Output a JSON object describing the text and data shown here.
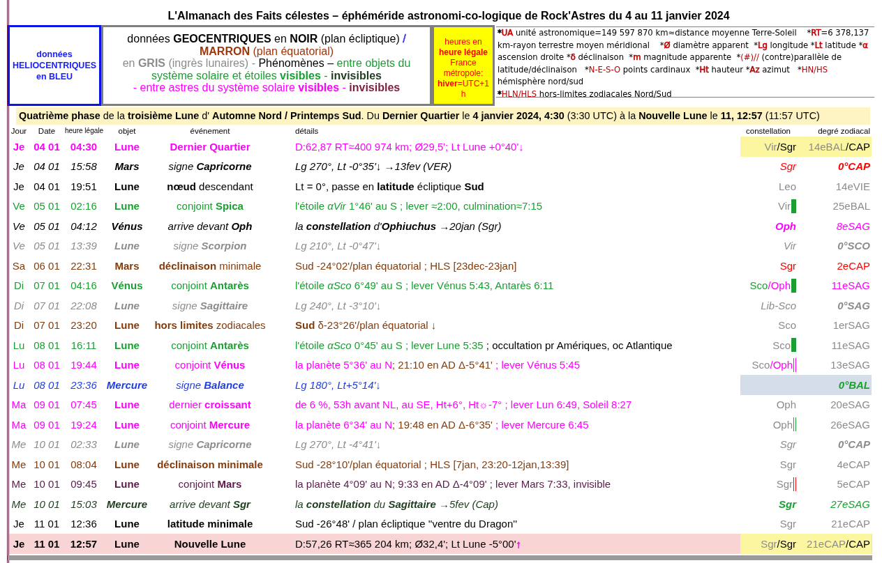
{
  "title": "L'Almanach des Faits célestes – éphéméride astronomi-co-logique de Rock'Astres du 4 au 11 janvier 2024",
  "legend": {
    "heliocentric": "données HELIOCENTRIQUES en BLEU",
    "geocentric": [
      [
        {
          "text": "données **GEOCENTRIQUES** en **NOIR** (plan écliptique)  ",
          "color": "#000000"
        },
        {
          "text": "/",
          "color": "#3030ff"
        }
      ],
      [
        {
          "text": "**MARRON** (plan équatorial)",
          "color": "#a0360c"
        }
      ],
      [
        {
          "text": "en **GRIS** (ingrès lunaires)  -  ",
          "color": "#8c8c8c"
        },
        {
          "text": "Phénomènes – ",
          "color": "#000000"
        },
        {
          "text": "entre objets du",
          "color": "#1aa032"
        }
      ],
      [
        {
          "text": "système solaire et étoiles **visibles** - ",
          "color": "#1aa032"
        },
        {
          "text": "**invisibles**",
          "color": "#1e3d1e"
        }
      ],
      [
        {
          "text": "- entre astres du système solaire **visibles** - ",
          "color": "#ff00ff"
        },
        {
          "text": "**invisibles**",
          "color": "#7a1f3d"
        }
      ]
    ],
    "time": [
      [
        {
          "text": "heures en",
          "color": "#ff0000"
        }
      ],
      [
        {
          "text": "**heure légale**",
          "color": "#ff0000"
        }
      ],
      [
        {
          "text": "France métropole:",
          "color": "#ff0000"
        }
      ],
      [
        {
          "text": "**hiver**=UTC+1 h",
          "color": "#ff0000"
        }
      ]
    ],
    "notes": [
      {
        "text": "*",
        "color": "#000000"
      },
      {
        "text": "UA",
        "color": "#c00000"
      },
      {
        "text": " unité astronomique=149 597 870 km≈distance moyenne Terre-Soleil    *",
        "color": "#000000"
      },
      {
        "text": "RT",
        "color": "#c00000"
      },
      {
        "text": "=6 378,137 km-rayon terrestre moyen méridional    *",
        "color": "#000000"
      },
      {
        "text": "Ø",
        "color": "#c00000"
      },
      {
        "text": " diamètre apparent  *",
        "color": "#000000"
      },
      {
        "text": "Lg",
        "color": "#c00000"
      },
      {
        "text": " longitude *",
        "color": "#000000"
      },
      {
        "text": "Lt",
        "color": "#c00000"
      },
      {
        "text": " latitude *",
        "color": "#000000"
      },
      {
        "text": "α",
        "color": "#c00000"
      },
      {
        "text": " ascension droite *",
        "color": "#000000"
      },
      {
        "text": "δ",
        "color": "#c00000"
      },
      {
        "text": " déclinaison  *",
        "color": "#000000"
      },
      {
        "text": "m",
        "color": "#c00000"
      },
      {
        "text": " magnitude apparente  *",
        "color": "#000000"
      },
      {
        "text": "(#)//",
        "color": "#c00000"
      },
      {
        "text": " (contre)parallèle de latitude/déclinaison   *",
        "color": "#000000"
      },
      {
        "text": "N-E-S-O",
        "color": "#c00000"
      },
      {
        "text": " points cardinaux  *",
        "color": "#000000"
      },
      {
        "text": "Ht",
        "color": "#c00000"
      },
      {
        "text": " hauteur *",
        "color": "#000000"
      },
      {
        "text": "Az",
        "color": "#c00000"
      },
      {
        "text": " azimut   *",
        "color": "#000000"
      },
      {
        "text": "HN/HS",
        "color": "#c00000"
      },
      {
        "text": " hémisphère nord/sud",
        "color": "#000000"
      },
      {
        "text": "*",
        "color": "#000000",
        "break": true
      },
      {
        "text": "HLN/HLS",
        "color": "#c00000"
      },
      {
        "text": " hors-limites zodiacales Nord/Sud",
        "color": "#000000"
      }
    ]
  },
  "phase": "**Quatrième phase** de la **troisième Lune** d' **Automne Nord / Printemps Sud**. Du **Dernier Quartier** le **4 janvier 2024, 4:30** (3:30 UTC) à la **Nouvelle Lune** le **11, 12:57** (11:57 UTC)",
  "columns": [
    "Jour",
    "Date",
    "heure légale",
    "objet",
    "événement",
    "détails",
    "constellation",
    "degré zodiacal"
  ],
  "rows": [
    {
      "color": "#ff00ff",
      "italic": false,
      "bold": true,
      "event_bold": true,
      "day": "Je",
      "date": "04 01",
      "time": "04:30",
      "object": "Lune",
      "event": "Dernier Quartier",
      "details": [
        {
          "text": "D:62,87 RT≈400 974 km; Ø29,5'; Lt Lune +0°40'↓",
          "color": "#ff00ff"
        }
      ],
      "constellation": [
        {
          "text": "Vir",
          "color": "#8c8c8c"
        },
        {
          "text": "/Sgr",
          "color": "#000000"
        }
      ],
      "degree": [
        {
          "text": "14eBAL",
          "color": "#8c8c8c"
        },
        {
          "text": "/CAP",
          "color": "#000000"
        }
      ],
      "cell_shade": {
        "color": "#fdf6a0"
      }
    },
    {
      "color": "#000000",
      "italic": true,
      "bold": false,
      "event_bold": false,
      "day": "Je",
      "date": "04 01",
      "time": "15:58",
      "object": "Mars",
      "event": "signe **Capricorne**",
      "details": [
        {
          "text": "Lg 270°, Lt -0°35'↓ →13fev (VER)",
          "color": "#000000"
        }
      ],
      "constellation": [
        {
          "text": "Sgr",
          "color": "#ff0000"
        }
      ],
      "degree": [
        {
          "text": "**0°CAP**",
          "color": "#ff0000"
        }
      ]
    },
    {
      "color": "#000000",
      "italic": false,
      "bold": false,
      "event_bold": false,
      "day": "Je",
      "date": "04 01",
      "time": "19:51",
      "object": "Lune",
      "event": "**nœud** descendant",
      "details": [
        {
          "text": "Lt = 0°, passe en **latitude** écliptique **Sud**",
          "color": "#000000"
        }
      ],
      "constellation": [
        {
          "text": "Leo",
          "color": "#8c8c8c"
        }
      ],
      "degree": [
        {
          "text": "14eVIE",
          "color": "#8c8c8c"
        }
      ]
    },
    {
      "color": "#1aa032",
      "italic": false,
      "bold": false,
      "event_bold": false,
      "day": "Ve",
      "date": "05 01",
      "time": "02:16",
      "object": "Lune",
      "event": "conjoint **Spica**",
      "details": [
        {
          "text": "l'étoile *αVir* 1°46' au S ; lever ≈2:00, culmination≈7:15",
          "color": "#1aa032"
        }
      ],
      "constellation": [
        {
          "text": "Vir",
          "color": "#8c8c8c"
        }
      ],
      "marker": {
        "kind": "bar",
        "color": "#1aa032"
      },
      "degree": [
        {
          "text": "25eBAL",
          "color": "#8c8c8c"
        }
      ]
    },
    {
      "color": "#000000",
      "italic": true,
      "bold": false,
      "event_bold": false,
      "day": "Ve",
      "date": "05 01",
      "time": "04:12",
      "object": "Vénus",
      "event": "arrive devant **Oph**",
      "details": [
        {
          "text": "la **constellation** d'**Ophiuchus** →20jan (Sgr)",
          "color": "#000000"
        }
      ],
      "constellation": [
        {
          "text": "**Oph**",
          "color": "#ff00ff"
        }
      ],
      "degree": [
        {
          "text": "8eSAG",
          "color": "#ff00ff"
        }
      ]
    },
    {
      "color": "#8c8c8c",
      "italic": true,
      "bold": false,
      "event_bold": false,
      "day": "Ve",
      "date": "05 01",
      "time": "13:39",
      "object": "Lune",
      "event": "signe **Scorpion**",
      "details": [
        {
          "text": "Lg 210°, Lt -0°47'↓",
          "color": "#8c8c8c"
        }
      ],
      "constellation": [
        {
          "text": "Vir",
          "color": "#8c8c8c"
        }
      ],
      "degree": [
        {
          "text": "**0°SCO**",
          "color": "#8c8c8c"
        }
      ]
    },
    {
      "color": "#843c0c",
      "italic": false,
      "bold": false,
      "event_bold": false,
      "day": "Sa",
      "date": "06 01",
      "time": "22:31",
      "object": "Mars",
      "event": "**déclinaison** minimale",
      "details": [
        {
          "text": "Sud -24°02'/plan équatorial ; HLS [23dec-23jan]",
          "color": "#843c0c"
        }
      ],
      "constellation": [
        {
          "text": "Sgr",
          "color": "#ff0000"
        }
      ],
      "degree": [
        {
          "text": "2eCAP",
          "color": "#ff0000"
        }
      ]
    },
    {
      "color": "#1aa032",
      "italic": false,
      "bold": false,
      "event_bold": false,
      "day": "Di",
      "date": "07 01",
      "time": "04:16",
      "object": "Vénus",
      "event": "conjoint **Antarès**",
      "details": [
        {
          "text": "l'étoile *αSco* 6°49' au S ; lever Vénus 5:43, Antarès 6:11",
          "color": "#1aa032"
        }
      ],
      "constellation": [
        {
          "text": "Sco",
          "color": "#1aa032"
        },
        {
          "text": "/Oph",
          "color": "#ff00ff"
        }
      ],
      "marker": {
        "kind": "bar",
        "color": "#1aa032"
      },
      "degree": [
        {
          "text": "11eSAG",
          "color": "#ff00ff"
        }
      ]
    },
    {
      "color": "#8c8c8c",
      "italic": true,
      "bold": false,
      "event_bold": false,
      "day": "Di",
      "date": "07 01",
      "time": "22:08",
      "object": "Lune",
      "event": "signe **Sagittaire**",
      "details": [
        {
          "text": "Lg 240°, Lt -3°10'↓",
          "color": "#8c8c8c"
        }
      ],
      "constellation": [
        {
          "text": "Lib-Sco",
          "color": "#8c8c8c"
        }
      ],
      "degree": [
        {
          "text": "**0°SAG**",
          "color": "#8c8c8c"
        }
      ]
    },
    {
      "color": "#843c0c",
      "italic": false,
      "bold": false,
      "event_bold": false,
      "day": "Di",
      "date": "07 01",
      "time": "23:20",
      "object": "Lune",
      "event": "**hors limites** zodiacales",
      "details": [
        {
          "text": "**Sud** δ-23°26'/plan équatorial ↓",
          "color": "#843c0c"
        }
      ],
      "constellation": [
        {
          "text": "Sco",
          "color": "#8c8c8c"
        }
      ],
      "degree": [
        {
          "text": "1erSAG",
          "color": "#8c8c8c"
        }
      ]
    },
    {
      "color": "#1aa032",
      "italic": false,
      "bold": false,
      "event_bold": false,
      "day": "Lu",
      "date": "08 01",
      "time": "16:11",
      "object": "Lune",
      "event": "conjoint **Antarès**",
      "details": [
        {
          "text": "l'étoile *αSco* 0°45' au S ; lever Lune 5:35",
          "color": "#1aa032"
        },
        {
          "text": " ; occultation pr Amériques, oc Atlantique",
          "color": "#000000"
        }
      ],
      "constellation": [
        {
          "text": "Sco",
          "color": "#8c8c8c"
        }
      ],
      "marker": {
        "kind": "bar",
        "color": "#1aa032"
      },
      "degree": [
        {
          "text": "11eSAG",
          "color": "#8c8c8c"
        }
      ]
    },
    {
      "color": "#ff00ff",
      "italic": false,
      "bold": false,
      "event_bold": false,
      "day": "Lu",
      "date": "08 01",
      "time": "19:44",
      "object": "Lune",
      "event": "conjoint **Vénus**",
      "details": [
        {
          "text": "la planète 5°36' au N",
          "color": "#ff00ff"
        },
        {
          "text": "; 21:10 en AD Δ-5°41'",
          "color": "#843c0c"
        },
        {
          "text": " ; lever Vénus 5:45",
          "color": "#ff00ff"
        }
      ],
      "constellation": [
        {
          "text": "Sco",
          "color": "#8c8c8c"
        },
        {
          "text": "/Oph",
          "color": "#ff00ff"
        }
      ],
      "marker": {
        "kind": "double",
        "color": "#ff00ff"
      },
      "degree": [
        {
          "text": "13eSAG",
          "color": "#8c8c8c"
        }
      ]
    },
    {
      "color": "#1f3fe0",
      "italic": true,
      "bold": false,
      "event_bold": false,
      "day": "Lu",
      "date": "08 01",
      "time": "23:36",
      "object": "Mercure",
      "event": "signe **Balance**",
      "details": [
        {
          "text": "Lg 180°, Lt+5°14'↓",
          "color": "#1f3fe0"
        }
      ],
      "constellation": [],
      "degree": [
        {
          "text": "**0°BAL**",
          "color": "#1aa032"
        }
      ],
      "cell_shade": {
        "color": "#d5dde8"
      }
    },
    {
      "color": "#ff00ff",
      "italic": false,
      "bold": false,
      "event_bold": false,
      "day": "Ma",
      "date": "09 01",
      "time": "07:45",
      "object": "Lune",
      "event": "dernier **croissant**",
      "details": [
        {
          "text": "de 6 %, 53h avant NL, au SE, Ht+6°, Ht☼-7° ; lever Lun 6:49, Soleil 8:27",
          "color": "#ff00ff"
        }
      ],
      "constellation": [
        {
          "text": "Oph",
          "color": "#8c8c8c"
        }
      ],
      "degree": [
        {
          "text": "20eSAG",
          "color": "#8c8c8c"
        }
      ]
    },
    {
      "color": "#ff00ff",
      "italic": false,
      "bold": false,
      "event_bold": false,
      "day": "Ma",
      "date": "09 01",
      "time": "19:24",
      "object": "Lune",
      "event": "conjoint **Mercure**",
      "details": [
        {
          "text": "la planète 6°34' au N",
          "color": "#ff00ff"
        },
        {
          "text": "; 19:48 en AD Δ-6°35'",
          "color": "#843c0c"
        },
        {
          "text": " ; lever Mercure 6:45",
          "color": "#ff00ff"
        }
      ],
      "constellation": [
        {
          "text": "Oph",
          "color": "#8c8c8c"
        }
      ],
      "marker": {
        "kind": "double",
        "color": "#1aa032"
      },
      "degree": [
        {
          "text": "26eSAG",
          "color": "#8c8c8c"
        }
      ]
    },
    {
      "color": "#8c8c8c",
      "italic": true,
      "bold": false,
      "event_bold": false,
      "day": "Me",
      "date": "10 01",
      "time": "02:33",
      "object": "Lune",
      "event": "signe **Capricorne**",
      "details": [
        {
          "text": "Lg 270°, Lt -4°41'↓",
          "color": "#8c8c8c"
        }
      ],
      "constellation": [
        {
          "text": "Sgr",
          "color": "#8c8c8c"
        }
      ],
      "degree": [
        {
          "text": "**0°CAP**",
          "color": "#8c8c8c"
        }
      ]
    },
    {
      "color": "#843c0c",
      "italic": false,
      "bold": false,
      "event_bold": true,
      "day": "Me",
      "date": "10 01",
      "time": "08:04",
      "object": "Lune",
      "event": "déclinaison minimale",
      "details": [
        {
          "text": "Sud -28°10'/plan équatorial ; HLS [7jan, 23:20-12jan,13:39]",
          "color": "#843c0c"
        }
      ],
      "constellation": [
        {
          "text": "Sgr",
          "color": "#8c8c8c"
        }
      ],
      "degree": [
        {
          "text": "4eCAP",
          "color": "#8c8c8c"
        }
      ]
    },
    {
      "color": "#5b1b4b",
      "italic": false,
      "bold": false,
      "event_bold": false,
      "day": "Me",
      "date": "10 01",
      "time": "09:45",
      "object": "Lune",
      "event": "conjoint **Mars**",
      "details": [
        {
          "text": "la planète 4°09' au N; 9:33 en AD Δ-4°09' ; lever Mars 7:33, invisible",
          "color": "#5b1b4b"
        }
      ],
      "constellation": [
        {
          "text": "Sgr",
          "color": "#8c8c8c"
        }
      ],
      "marker": {
        "kind": "double",
        "color": "#ff0000"
      },
      "degree": [
        {
          "text": "5eCAP",
          "color": "#8c8c8c"
        }
      ]
    },
    {
      "color": "#1e3d1e",
      "italic": true,
      "bold": false,
      "event_bold": false,
      "day": "Me",
      "date": "10 01",
      "time": "15:03",
      "object": "Mercure",
      "event": "arrive devant **Sgr**",
      "details": [
        {
          "text": "la **constellation** du **Sagittaire** →5fev (Cap)",
          "color": "#1e3d1e"
        }
      ],
      "constellation": [
        {
          "text": "**Sgr**",
          "color": "#1aa032"
        }
      ],
      "degree": [
        {
          "text": "27eSAG",
          "color": "#1aa032"
        }
      ]
    },
    {
      "color": "#000000",
      "italic": false,
      "bold": false,
      "event_bold": true,
      "day": "Je",
      "date": "11 01",
      "time": "12:36",
      "object": "Lune",
      "event": "latitude minimale",
      "details": [
        {
          "text": "Sud -26°48' / plan écliptique ''ventre du Dragon''",
          "color": "#000000"
        }
      ],
      "constellation": [
        {
          "text": "Sgr",
          "color": "#8c8c8c"
        }
      ],
      "degree": [
        {
          "text": "21eCAP",
          "color": "#8c8c8c"
        }
      ]
    },
    {
      "color": "#000000",
      "italic": false,
      "bold": true,
      "event_bold": true,
      "day": "Je",
      "date": "11 01",
      "time": "12:57",
      "object": "Lune",
      "event": "Nouvelle Lune",
      "details": [
        {
          "text": "D:57,26 RT≈365 204 km; Ø32,4'; Lt Lune -5°00'",
          "color": "#000000"
        },
        {
          "text": "↑",
          "color": "#ff00ff"
        }
      ],
      "constellation": [
        {
          "text": "Sgr",
          "color": "#8c8c8c"
        },
        {
          "text": "/Sgr",
          "color": "#000000"
        }
      ],
      "degree": [
        {
          "text": "21eCAP",
          "color": "#8c8c8c"
        },
        {
          "text": "/CAP",
          "color": "#000000"
        }
      ],
      "shade": {
        "color": "#f8d4d4"
      },
      "cell_shade": {
        "color": "#fdf6a0"
      }
    }
  ]
}
